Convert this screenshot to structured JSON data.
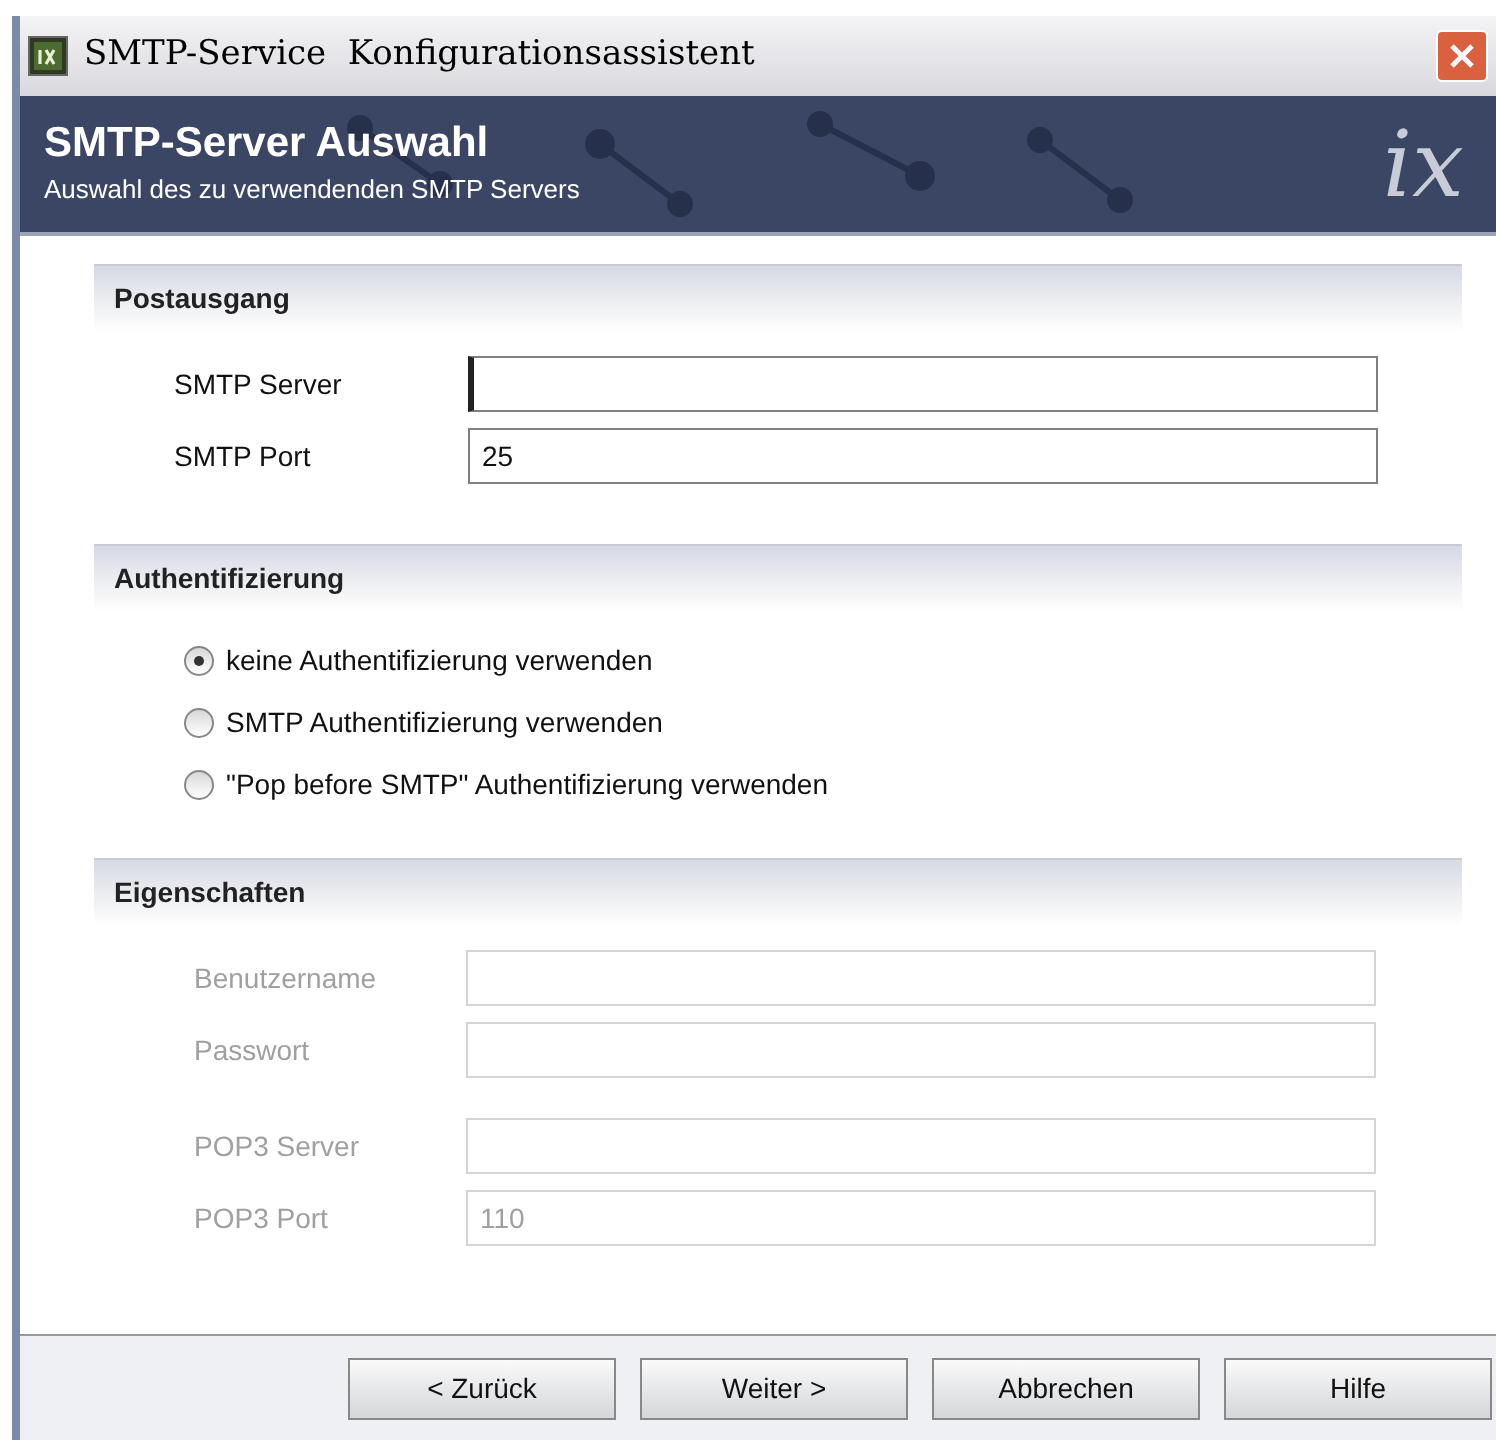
{
  "window": {
    "title": "SMTP-Service  Konfigurationsassistent"
  },
  "banner": {
    "title": "SMTP-Server Auswahl",
    "subtitle": "Auswahl des zu verwendenden SMTP Servers",
    "logo": "ix"
  },
  "sections": [
    {
      "kind": "fields",
      "title": "Postausgang",
      "fields": [
        {
          "label": "SMTP Server",
          "focused": true,
          "disabled": false
        },
        {
          "label": "SMTP Port",
          "value": "25",
          "focused": false,
          "disabled": false
        }
      ]
    },
    {
      "kind": "radios",
      "title": "Authentifizierung",
      "options": [
        {
          "label": "keine Authentifizierung verwenden",
          "selected": true
        },
        {
          "label": "SMTP Authentifizierung verwenden",
          "selected": false
        },
        {
          "label": "\"Pop before SMTP\" Authentifizierung verwenden",
          "selected": false
        }
      ]
    },
    {
      "kind": "fields",
      "title": "Eigenschaften",
      "fields": [
        {
          "label": "Benutzername",
          "focused": false,
          "disabled": true
        },
        {
          "label": "Passwort",
          "focused": false,
          "disabled": true
        },
        {
          "label": "POP3 Server",
          "focused": false,
          "disabled": true
        },
        {
          "label": "POP3 Port",
          "value": "110",
          "focused": false,
          "disabled": true
        }
      ]
    }
  ],
  "buttons": [
    "< Zurück",
    "Weiter >",
    "Abbrechen",
    "Hilfe"
  ]
}
